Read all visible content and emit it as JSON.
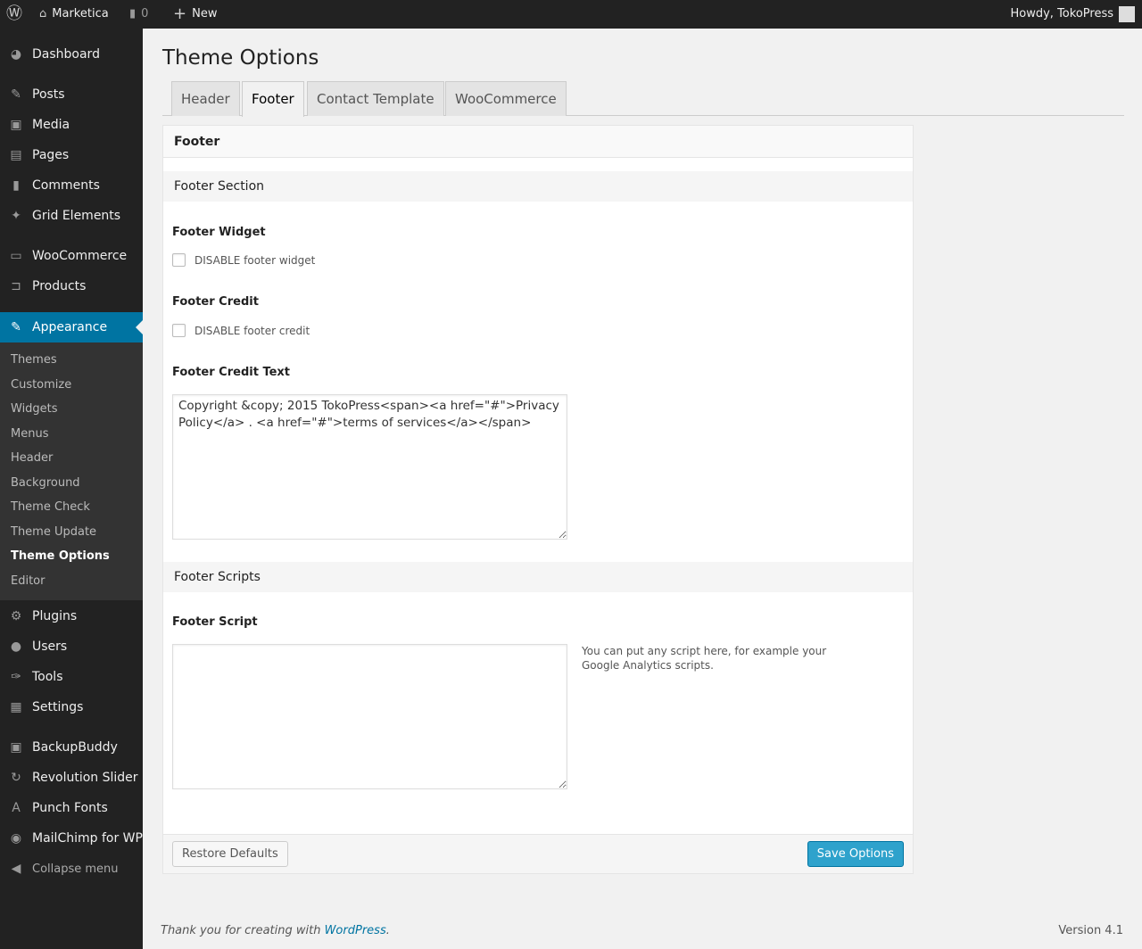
{
  "adminbar": {
    "site": "Marketica",
    "comments": "0",
    "new": "New",
    "howdy": "Howdy, TokoPress"
  },
  "sidebar": {
    "items": [
      "Dashboard",
      "Posts",
      "Media",
      "Pages",
      "Comments",
      "Grid Elements",
      "WooCommerce",
      "Products",
      "Appearance",
      "Plugins",
      "Users",
      "Tools",
      "Settings",
      "BackupBuddy",
      "Revolution Slider",
      "Punch Fonts",
      "MailChimp for WP",
      "Collapse menu"
    ],
    "submenu": [
      "Themes",
      "Customize",
      "Widgets",
      "Menus",
      "Header",
      "Background",
      "Theme Check",
      "Theme Update",
      "Theme Options",
      "Editor"
    ]
  },
  "page": {
    "title": "Theme Options",
    "tabs": [
      "Header",
      "Footer",
      "Contact Template",
      "WooCommerce"
    ]
  },
  "panel": {
    "title": "Footer",
    "section1": "Footer Section",
    "footer_widget_label": "Footer Widget",
    "footer_widget_cb": "DISABLE footer widget",
    "footer_credit_label": "Footer Credit",
    "footer_credit_cb": "DISABLE footer credit",
    "credit_text_label": "Footer Credit Text",
    "credit_text": "Copyright &copy; 2015 TokoPress<span><a href=\"#\">Privacy Policy</a> . <a href=\"#\">terms of services</a></span>",
    "section2": "Footer Scripts",
    "script_label": "Footer Script",
    "script_value": "",
    "script_help": "You can put any script here, for example your Google Analytics scripts.",
    "restore": "Restore Defaults",
    "save": "Save Options"
  },
  "footer": {
    "thanks": "Thank you for creating with ",
    "wp": "WordPress",
    "dot": ".",
    "version": "Version 4.1"
  },
  "colors": {
    "accent": "#0074a2",
    "button": "#2ea2cc"
  }
}
